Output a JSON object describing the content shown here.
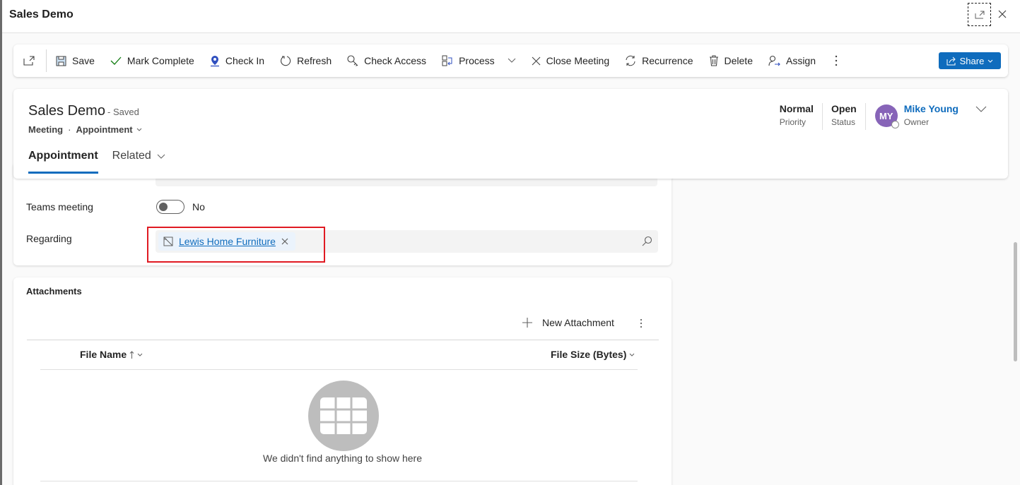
{
  "dialog": {
    "title": "Sales Demo"
  },
  "commands": {
    "items": [
      {
        "label": "Save",
        "icon": "save-icon"
      },
      {
        "label": "Mark Complete",
        "icon": "check-icon"
      },
      {
        "label": "Check In",
        "icon": "location-icon"
      },
      {
        "label": "Refresh",
        "icon": "refresh-icon"
      },
      {
        "label": "Check Access",
        "icon": "key-icon"
      },
      {
        "label": "Process",
        "icon": "process-icon"
      },
      {
        "label": "Close Meeting",
        "icon": "close-icon"
      },
      {
        "label": "Recurrence",
        "icon": "recurrence-icon"
      },
      {
        "label": "Delete",
        "icon": "delete-icon"
      },
      {
        "label": "Assign",
        "icon": "assign-icon"
      }
    ],
    "share_label": "Share",
    "accent": "#0f6cbd"
  },
  "record": {
    "title": "Sales Demo",
    "save_state": "- Saved",
    "entity": "Meeting",
    "form": "Appointment",
    "tabs": [
      {
        "label": "Appointment"
      },
      {
        "label": "Related"
      }
    ],
    "header_fields": [
      {
        "value": "Normal",
        "label": "Priority"
      },
      {
        "value": "Open",
        "label": "Status"
      }
    ],
    "owner": {
      "name": "Mike Young",
      "label": "Owner",
      "initials": "MY",
      "avatar_color": "#8764b8"
    }
  },
  "form": {
    "teams_meeting": {
      "label": "Teams meeting",
      "value": "No"
    },
    "regarding": {
      "label": "Regarding",
      "value": "Lewis Home Furniture"
    }
  },
  "attachments": {
    "title": "Attachments",
    "new_label": "New Attachment",
    "columns": [
      {
        "label": "File Name"
      },
      {
        "label": "File Size (Bytes)"
      }
    ],
    "empty_message": "We didn't find anything to show here"
  }
}
